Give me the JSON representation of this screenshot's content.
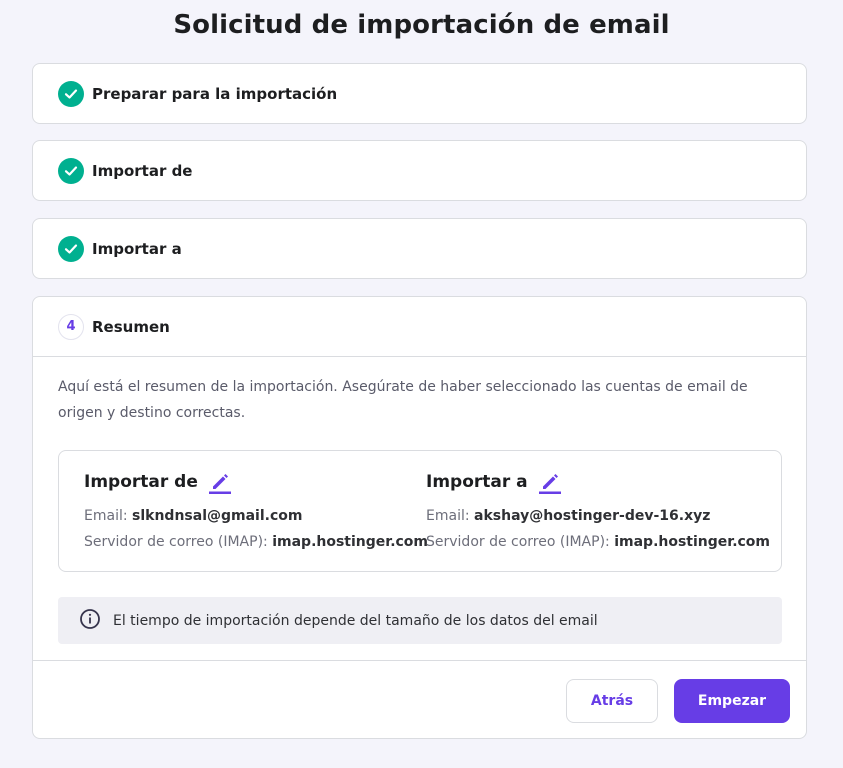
{
  "title": "Solicitud de importación de email",
  "steps": [
    {
      "label": "Preparar para la importación",
      "status": "done"
    },
    {
      "label": "Importar de",
      "status": "done"
    },
    {
      "label": "Importar a",
      "status": "done"
    }
  ],
  "summary": {
    "number": "4",
    "label": "Resumen",
    "intro": "Aquí está el resumen de la importación. Asegúrate de haber seleccionado las cuentas de email de origen y destino correctas.",
    "from": {
      "title": "Importar de",
      "email_label": "Email:",
      "email": "slkndnsal@gmail.com",
      "server_label": "Servidor de correo (IMAP):",
      "server": "imap.hostinger.com"
    },
    "to": {
      "title": "Importar a",
      "email_label": "Email:",
      "email": "akshay@hostinger-dev-16.xyz",
      "server_label": "Servidor de correo (IMAP):",
      "server": "imap.hostinger.com"
    },
    "notice": "El tiempo de importación depende del tamaño de los datos del email"
  },
  "buttons": {
    "back": "Atrás",
    "start": "Empezar"
  },
  "colors": {
    "accent": "#673de6",
    "success": "#00b090",
    "background": "#f4f4fb"
  },
  "icons": {
    "step_done": "check-circle-icon",
    "edit": "pencil-edit-icon",
    "info": "info-icon"
  }
}
